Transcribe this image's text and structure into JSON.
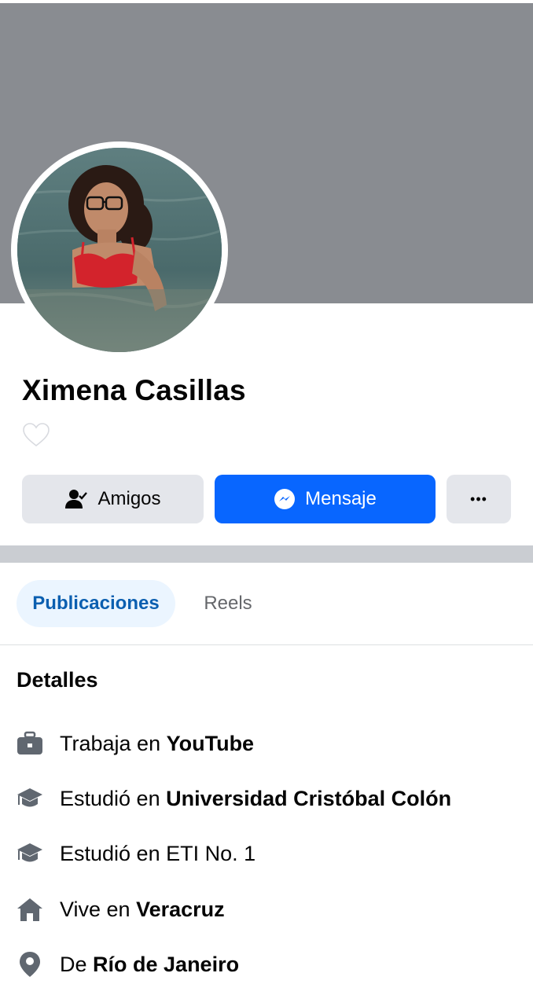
{
  "profile": {
    "name": "Ximena Casillas"
  },
  "actions": {
    "friends_label": "Amigos",
    "message_label": "Mensaje",
    "more_label": "•••"
  },
  "tabs": {
    "posts": "Publicaciones",
    "reels": "Reels"
  },
  "details": {
    "title": "Detalles",
    "items": [
      {
        "icon": "briefcase-icon",
        "prefix": "Trabaja en ",
        "bold": "YouTube"
      },
      {
        "icon": "graduation-cap-icon",
        "prefix": "Estudió en ",
        "bold": "Universidad Cristóbal Colón"
      },
      {
        "icon": "graduation-cap-icon",
        "prefix": "Estudió en ETI No. 1",
        "bold": ""
      },
      {
        "icon": "home-icon",
        "prefix": "Vive en ",
        "bold": "Veracruz"
      },
      {
        "icon": "location-pin-icon",
        "prefix": "De ",
        "bold": "Río de Janeiro"
      }
    ]
  },
  "colors": {
    "cover": "#898c91",
    "accent": "#0866ff",
    "tab_active_bg": "#ebf5ff",
    "tab_active_text": "#0b5fb0"
  }
}
